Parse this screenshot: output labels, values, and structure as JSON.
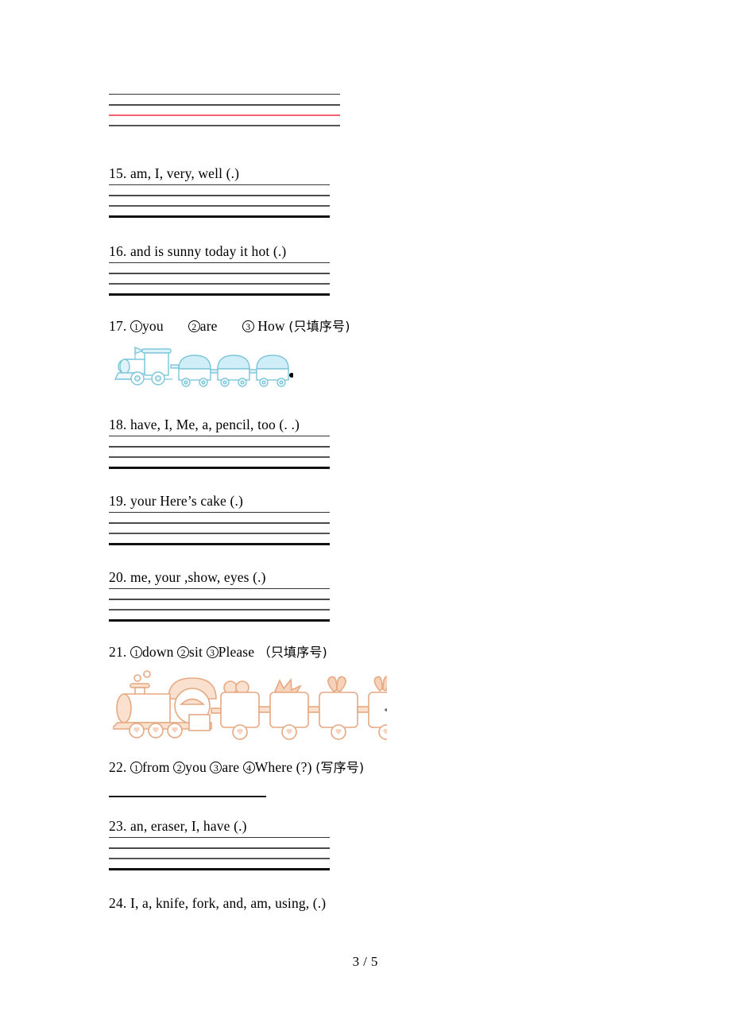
{
  "document": {
    "page_label": "3 / 5",
    "page_current": "3",
    "page_separator": "/",
    "page_total": "5"
  },
  "colors": {
    "ink": "#000000",
    "rule_dark": "#111111",
    "rule_mid": "#4a4a4a",
    "rule_light": "#3a3338",
    "rule_red": "#f4606c",
    "train_blue_fill": "#d9f1f7",
    "train_blue_stroke": "#7fc8dd",
    "train_peach_fill": "#f8ddcb",
    "train_peach_stroke": "#e8a77e"
  },
  "top_block": {
    "name": "continuation-answer-lines",
    "lines": [
      {
        "style": "thin"
      },
      {
        "style": "med"
      },
      {
        "style": "red"
      },
      {
        "style": "med2"
      }
    ]
  },
  "items": [
    {
      "number": "15.",
      "prompt": "am, I, very, well (.)",
      "kind": "reorder",
      "lines": 4
    },
    {
      "number": "16.",
      "prompt": "and  is  sunny  today  it  hot (.)",
      "kind": "reorder",
      "lines": 4
    },
    {
      "number": "17.",
      "kind": "ordering-choices",
      "choices": [
        {
          "circle": "1",
          "word": "you"
        },
        {
          "circle": "2",
          "word": "are"
        },
        {
          "circle": "3",
          "word": "How"
        }
      ],
      "instruction": "(只填序号)",
      "illustration": "train-blue"
    },
    {
      "number": "18.",
      "prompt": "have, I, Me, a, pencil, too (. .)",
      "kind": "reorder",
      "lines": 4
    },
    {
      "number": "19.",
      "prompt": "your  Here’s  cake (.)",
      "kind": "reorder",
      "lines": 4
    },
    {
      "number": "20.",
      "prompt": "me, your ,show, eyes (.)",
      "kind": "reorder",
      "lines": 4
    },
    {
      "number": "21.",
      "kind": "ordering-choices",
      "choices": [
        {
          "circle": "1",
          "word": "down"
        },
        {
          "circle": "2",
          "word": "sit"
        },
        {
          "circle": "3",
          "word": "Please"
        }
      ],
      "instruction": "（只填序号)",
      "illustration": "train-peach"
    },
    {
      "number": "22.",
      "kind": "ordering-choices",
      "choices": [
        {
          "circle": "1",
          "word": "from"
        },
        {
          "circle": "2",
          "word": "you"
        },
        {
          "circle": "3",
          "word": "are"
        },
        {
          "circle": "4",
          "word": "Where"
        }
      ],
      "suffix": "(?)",
      "instruction": "(写序号)",
      "lines": 1
    },
    {
      "number": "23.",
      "prompt": "an, eraser, I, have (.)",
      "kind": "reorder",
      "lines": 4
    },
    {
      "number": "24.",
      "prompt": "I, a, knife, fork, and, am, using, (.)",
      "kind": "reorder",
      "lines": 0
    }
  ]
}
